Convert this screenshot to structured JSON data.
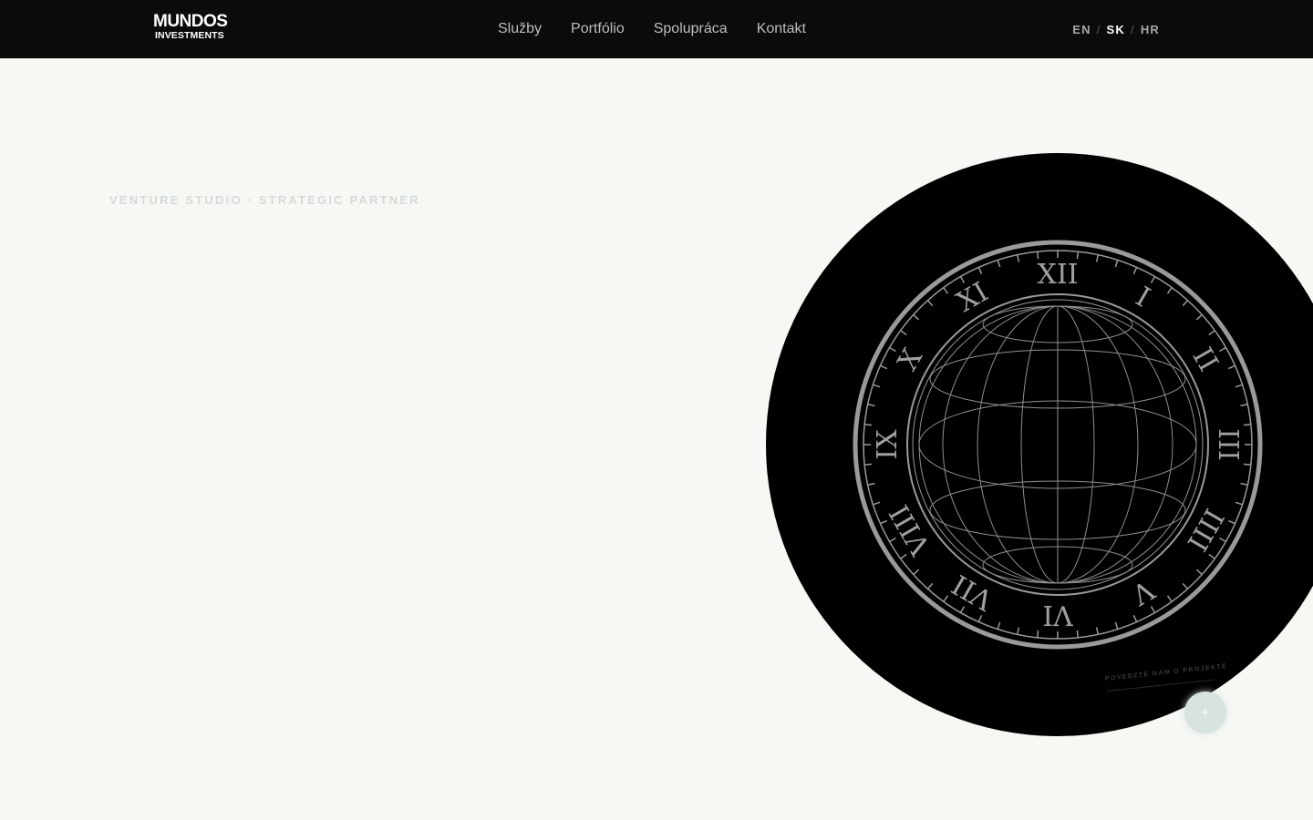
{
  "header": {
    "logo_top": "MUNDOS",
    "logo_bottom": "INVESTMENTS",
    "nav": [
      {
        "label": "Služby"
      },
      {
        "label": "Portfólio"
      },
      {
        "label": "Spolupráca"
      },
      {
        "label": "Kontakt"
      }
    ],
    "languages": {
      "en": "EN",
      "sk": "SK",
      "hr": "HR",
      "separator": "/",
      "active": "SK"
    }
  },
  "hero": {
    "eyebrow": "VENTURE STUDIO · STRATEGIC PARTNER",
    "visual_icon": "clock-globe-icon"
  },
  "cta": {
    "label": "POVEDZTE NÁM O PROJEKTE",
    "button_symbol": "+",
    "button_icon": "plus-icon"
  },
  "colors": {
    "header_bg": "#0b0b0b",
    "page_bg": "#f7f8f4",
    "eyebrow": "#d3dcd6",
    "circle": "#000000",
    "fab": "#d8e3de"
  }
}
